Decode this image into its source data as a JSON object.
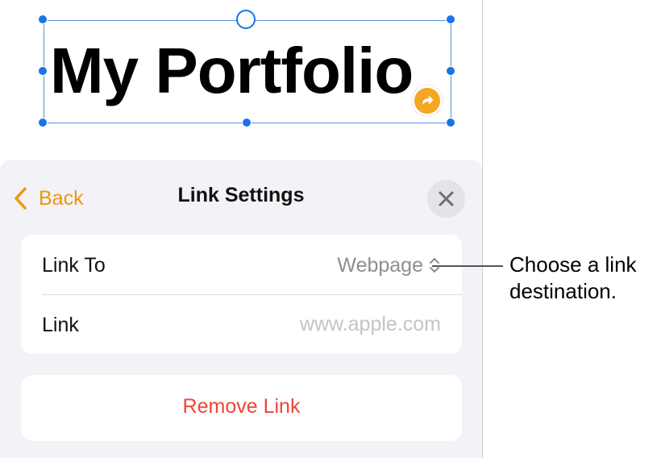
{
  "canvas": {
    "title_text": "My Portfolio",
    "selection_color": "#1a73e8",
    "link_badge_color": "#f5a623",
    "link_badge_icon": "curved-arrow-icon"
  },
  "sheet": {
    "back_label": "Back",
    "title": "Link Settings",
    "close_icon": "close-icon",
    "accent_color": "#f0960e"
  },
  "link_group": {
    "link_to_label": "Link To",
    "link_to_value": "Webpage",
    "link_label": "Link",
    "link_value": "",
    "link_placeholder": "www.apple.com"
  },
  "remove_link_label": "Remove Link",
  "destructive_color": "#f04438",
  "callout": {
    "line1": "Choose a link",
    "line2": "destination."
  }
}
